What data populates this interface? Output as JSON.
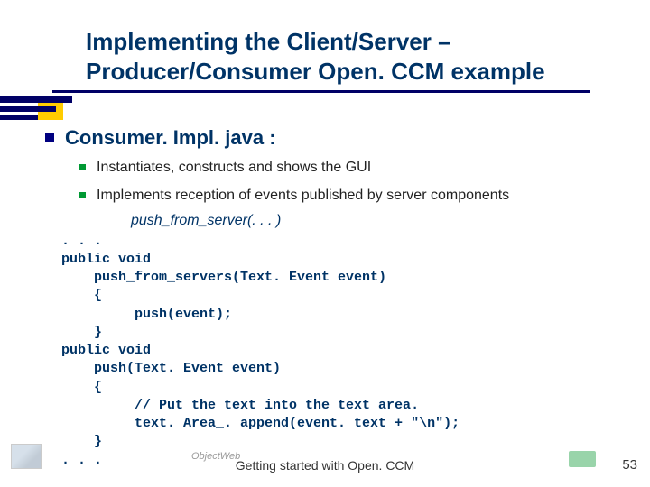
{
  "title_line1": "Implementing the Client/Server –",
  "title_line2": "Producer/Consumer Open. CCM example",
  "heading": "Consumer. Impl. java :",
  "bullets": [
    "Instantiates, constructs and shows the GUI",
    "Implements reception of events published by server components"
  ],
  "bullet2_italic": "push_from_server(. . . )",
  "code": ". . .\npublic void\n    push_from_servers(Text. Event event)\n    {\n         push(event);\n    }\npublic void\n    push(Text. Event event)\n    {\n         // Put the text into the text area.\n         text. Area_. append(event. text + \"\\n\");\n    }\n. . .",
  "footer": {
    "caption": "Getting started with Open. CCM",
    "page": "53",
    "logo_mid": "ObjectWeb"
  }
}
